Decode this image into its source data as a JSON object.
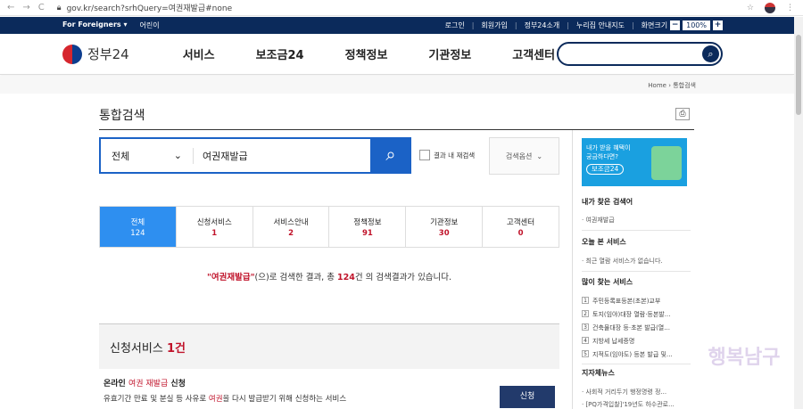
{
  "browser": {
    "back": "←",
    "forward": "→",
    "reload": "C",
    "url": "gov.kr/search?srhQuery=여권재발급#none"
  },
  "topbar": {
    "foreigners": "For Foreigners ▾",
    "kids": "어린이",
    "links": [
      "로그인",
      "회원가입",
      "정부24소개",
      "누리집 안내지도",
      "화면크기"
    ],
    "zoom_minus": "−",
    "zoom_value": "100%",
    "zoom_plus": "+"
  },
  "header": {
    "logo": "정부24",
    "nav": [
      "서비스",
      "보조금24",
      "정책정보",
      "기관정보",
      "고객센터"
    ],
    "search_icon": "search-icon"
  },
  "breadcrumb": {
    "home": "Home",
    "current": "통합검색"
  },
  "page": {
    "title": "통합검색"
  },
  "search": {
    "scope": "전체",
    "query": "여권재발급",
    "recheck_label": "결과 내 재검색",
    "options_label": "검색옵션"
  },
  "tabs": [
    {
      "label": "전체",
      "count": "124"
    },
    {
      "label": "신청서비스",
      "count": "1"
    },
    {
      "label": "서비스안내",
      "count": "2"
    },
    {
      "label": "정책정보",
      "count": "91"
    },
    {
      "label": "기관정보",
      "count": "30"
    },
    {
      "label": "고객센터",
      "count": "0"
    }
  ],
  "summary": {
    "keyword": "\"여권재발급\"",
    "part1": "(으)로 검색한 결과, 총 ",
    "count": "124",
    "part2": "건 의 검색결과가 있습니다."
  },
  "section": {
    "title": "신청서비스 ",
    "count": "1건"
  },
  "service": {
    "title_prefix": "온라인 ",
    "title_hl": "여권 재발급",
    "title_suffix": " 신청",
    "desc_prefix": "유효기간 만료 및 분실 등 사유로 ",
    "desc_hl": "여권",
    "desc_suffix": "을 다시 발급받기 위해 신청하는 서비스",
    "apply": "신청"
  },
  "sidebar": {
    "banner_line1": "내가 받을 혜택이",
    "banner_line2": "궁금하다면?",
    "banner_badge": "보조금24",
    "my_searches_title": "내가 찾은 검색어",
    "my_searches": [
      "여권재발급"
    ],
    "today_title": "오늘 본 서비스",
    "today_empty": "최근 열람 서비스가 없습니다.",
    "popular_title": "많이 찾는 서비스",
    "popular": [
      {
        "no": "1",
        "text": "주민등록표등본(초본)교부"
      },
      {
        "no": "2",
        "text": "토지(임야)대장 열람·등본발..."
      },
      {
        "no": "3",
        "text": "건축물대장 등·초본 발급(열..."
      },
      {
        "no": "4",
        "text": "지방세 납세증명"
      },
      {
        "no": "5",
        "text": "지적도(임야도) 등본 발급 및..."
      }
    ],
    "knowledge_title": "지자체뉴스",
    "knowledge": [
      "사회적 거리두기 행정명령 정...",
      "[PQ가격입찰]'19년도 하수관로..."
    ]
  },
  "watermark": "행복남구"
}
